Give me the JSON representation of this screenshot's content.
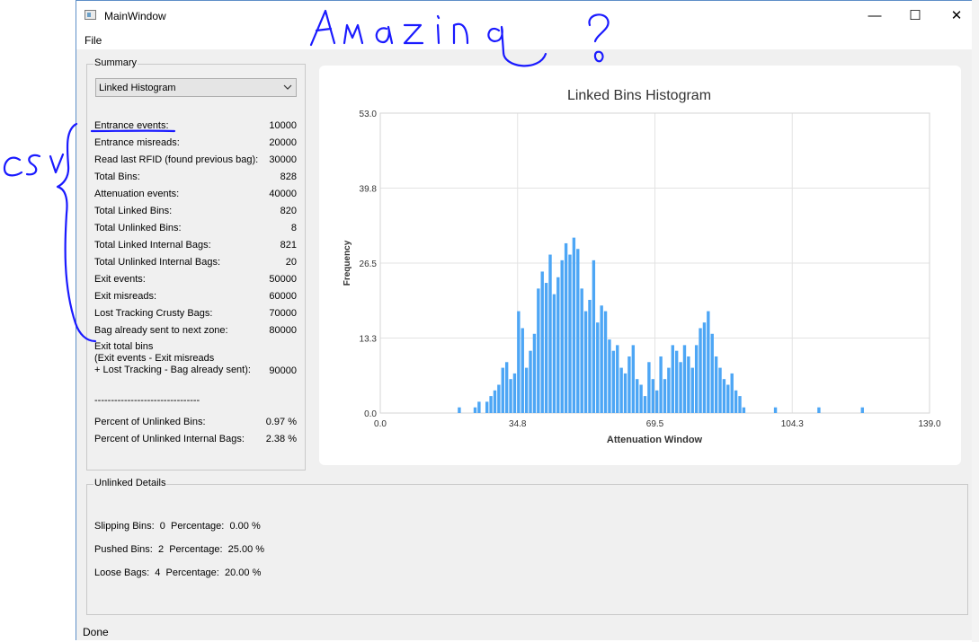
{
  "window": {
    "title": "MainWindow",
    "minimize": "—",
    "maximize": "☐",
    "close": "✕"
  },
  "menu": {
    "file": "File"
  },
  "summary": {
    "group_title": "Summary",
    "combo_value": "Linked Histogram",
    "rows": [
      {
        "label": "Entrance events:",
        "value": "10000"
      },
      {
        "label": "Entrance misreads:",
        "value": "20000"
      },
      {
        "label": "Read last RFID (found previous bag):",
        "value": "30000"
      },
      {
        "label": "Total Bins:",
        "value": "828"
      },
      {
        "label": "Attenuation events:",
        "value": "40000"
      },
      {
        "label": "Total Linked Bins:",
        "value": "820"
      },
      {
        "label": "Total Unlinked Bins:",
        "value": "8"
      },
      {
        "label": "Total Linked Internal Bags:",
        "value": "821"
      },
      {
        "label": "Total Unlinked Internal Bags:",
        "value": "20"
      },
      {
        "label": "Exit events:",
        "value": "50000"
      },
      {
        "label": "Exit misreads:",
        "value": "60000"
      },
      {
        "label": "Lost Tracking Crusty Bags:",
        "value": "70000"
      },
      {
        "label": "Bag already sent to next zone:",
        "value": "80000"
      }
    ],
    "exit_total": {
      "line1": "Exit total bins",
      "line2": "(Exit events - Exit misreads",
      "line3": "+ Lost Tracking - Bag already sent):",
      "value": "90000"
    },
    "separator": "--------------------------------",
    "percent_rows": [
      {
        "label": "Percent of Unlinked Bins:",
        "value": "0.97 %"
      },
      {
        "label": "Percent of Unlinked Internal Bags:",
        "value": "2.38 %"
      }
    ]
  },
  "unlinked": {
    "group_title": "Unlinked Details",
    "rows": [
      {
        "label": "Slipping Bins:",
        "count": "0",
        "pct_label": "Percentage:",
        "pct": "0.00 %"
      },
      {
        "label": "Pushed Bins:",
        "count": "2",
        "pct_label": "Percentage:",
        "pct": "25.00 %"
      },
      {
        "label": "Loose Bags:",
        "count": "4",
        "pct_label": "Percentage:",
        "pct": "20.00 %"
      }
    ]
  },
  "status": {
    "text": "Done"
  },
  "annotations": {
    "handwriting_top": "Amazing ?",
    "handwriting_left": "CSV",
    "ink_color": "#1a1aff"
  },
  "chart_data": {
    "type": "bar",
    "title": "Linked Bins Histogram",
    "xlabel": "Attenuation Window",
    "ylabel": "Frequency",
    "xlim": [
      0.0,
      139.0
    ],
    "ylim": [
      0.0,
      53.0
    ],
    "xticks": [
      "0.0",
      "34.8",
      "69.5",
      "104.3",
      "139.0"
    ],
    "yticks": [
      "0.0",
      "13.3",
      "26.5",
      "39.8",
      "53.0"
    ],
    "grid": true,
    "bar_color": "#4da6f5",
    "x": [
      20,
      24,
      25,
      27,
      28,
      29,
      30,
      31,
      32,
      33,
      34,
      35,
      36,
      37,
      38,
      39,
      40,
      41,
      42,
      43,
      44,
      45,
      46,
      47,
      48,
      49,
      50,
      51,
      52,
      53,
      54,
      55,
      56,
      57,
      58,
      59,
      60,
      61,
      62,
      63,
      64,
      65,
      66,
      67,
      68,
      69,
      70,
      71,
      72,
      73,
      74,
      75,
      76,
      77,
      78,
      79,
      80,
      81,
      82,
      83,
      84,
      85,
      86,
      87,
      88,
      89,
      90,
      91,
      92,
      100,
      111,
      122
    ],
    "values": [
      1,
      1,
      2,
      2,
      3,
      4,
      5,
      8,
      9,
      6,
      7,
      18,
      15,
      8,
      11,
      14,
      22,
      25,
      23,
      28,
      21,
      24,
      27,
      30,
      28,
      31,
      29,
      22,
      18,
      20,
      27,
      16,
      19,
      18,
      13,
      11,
      12,
      8,
      7,
      10,
      12,
      6,
      5,
      3,
      9,
      6,
      4,
      10,
      6,
      8,
      12,
      11,
      9,
      12,
      10,
      8,
      12,
      15,
      16,
      18,
      14,
      10,
      8,
      6,
      5,
      7,
      4,
      3,
      1,
      1,
      1,
      1
    ]
  }
}
